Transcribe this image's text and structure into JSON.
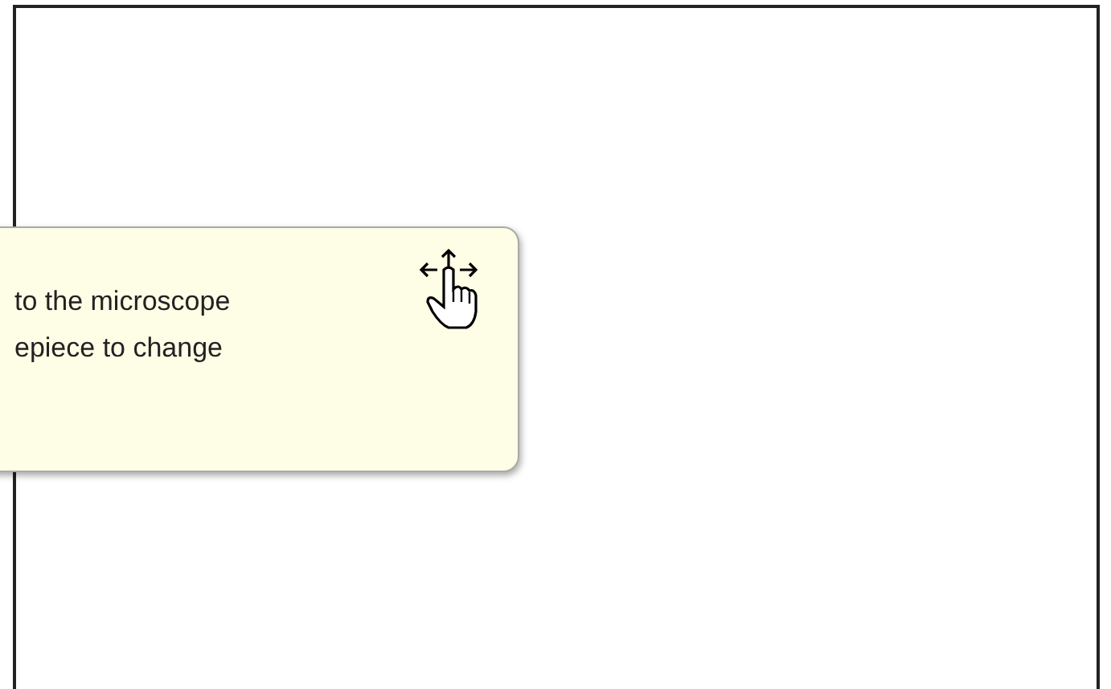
{
  "tooltip": {
    "lines": [
      "to the microscope",
      "epiece to change"
    ]
  }
}
